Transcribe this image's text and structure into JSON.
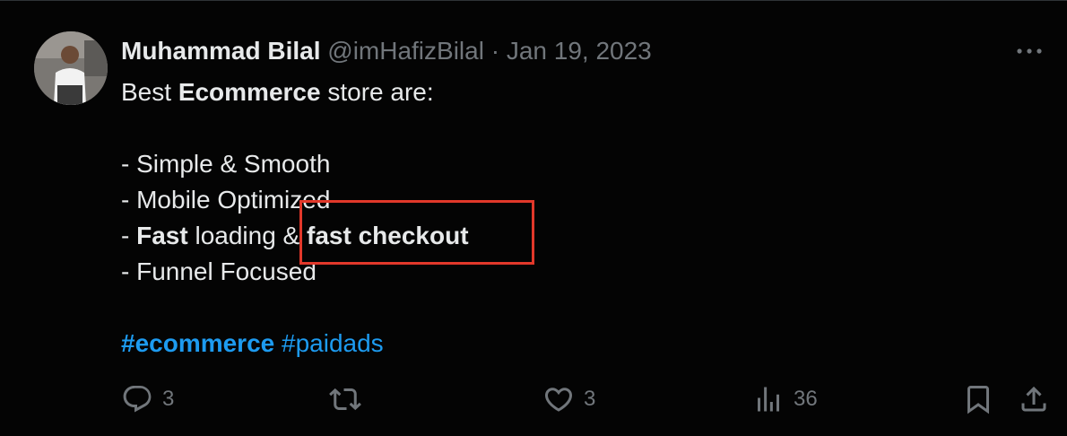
{
  "tweet": {
    "author_name": "Muhammad Bilal",
    "handle": "@imHafizBilal",
    "separator": "·",
    "date": "Jan 19, 2023",
    "more_icon": "more-dots-icon",
    "lines": {
      "l1_pre": "Best ",
      "l1_bold": "Ecommerce",
      "l1_post": " store are:",
      "l2": "- Simple & Smooth",
      "l3": "- Mobile Optimized",
      "l4_pre": "- ",
      "l4_bold1": "Fast",
      "l4_mid": " loading & ",
      "l4_bold2": "fast checkout",
      "l5": "- Funnel Focused"
    },
    "hashtags": [
      "#ecommerce",
      "#paidads"
    ],
    "actions": {
      "reply": {
        "icon": "reply-icon",
        "count": "3"
      },
      "retweet": {
        "icon": "retweet-icon",
        "count": ""
      },
      "like": {
        "icon": "heart-icon",
        "count": "3"
      },
      "views": {
        "icon": "analytics-icon",
        "count": "36"
      },
      "bookmark": {
        "icon": "bookmark-icon"
      },
      "share": {
        "icon": "share-icon"
      }
    },
    "colors": {
      "background": "#040404",
      "text": "#e7e9ea",
      "secondary": "#71767b",
      "link": "#1d9bf0",
      "highlight": "#e2382a"
    }
  }
}
